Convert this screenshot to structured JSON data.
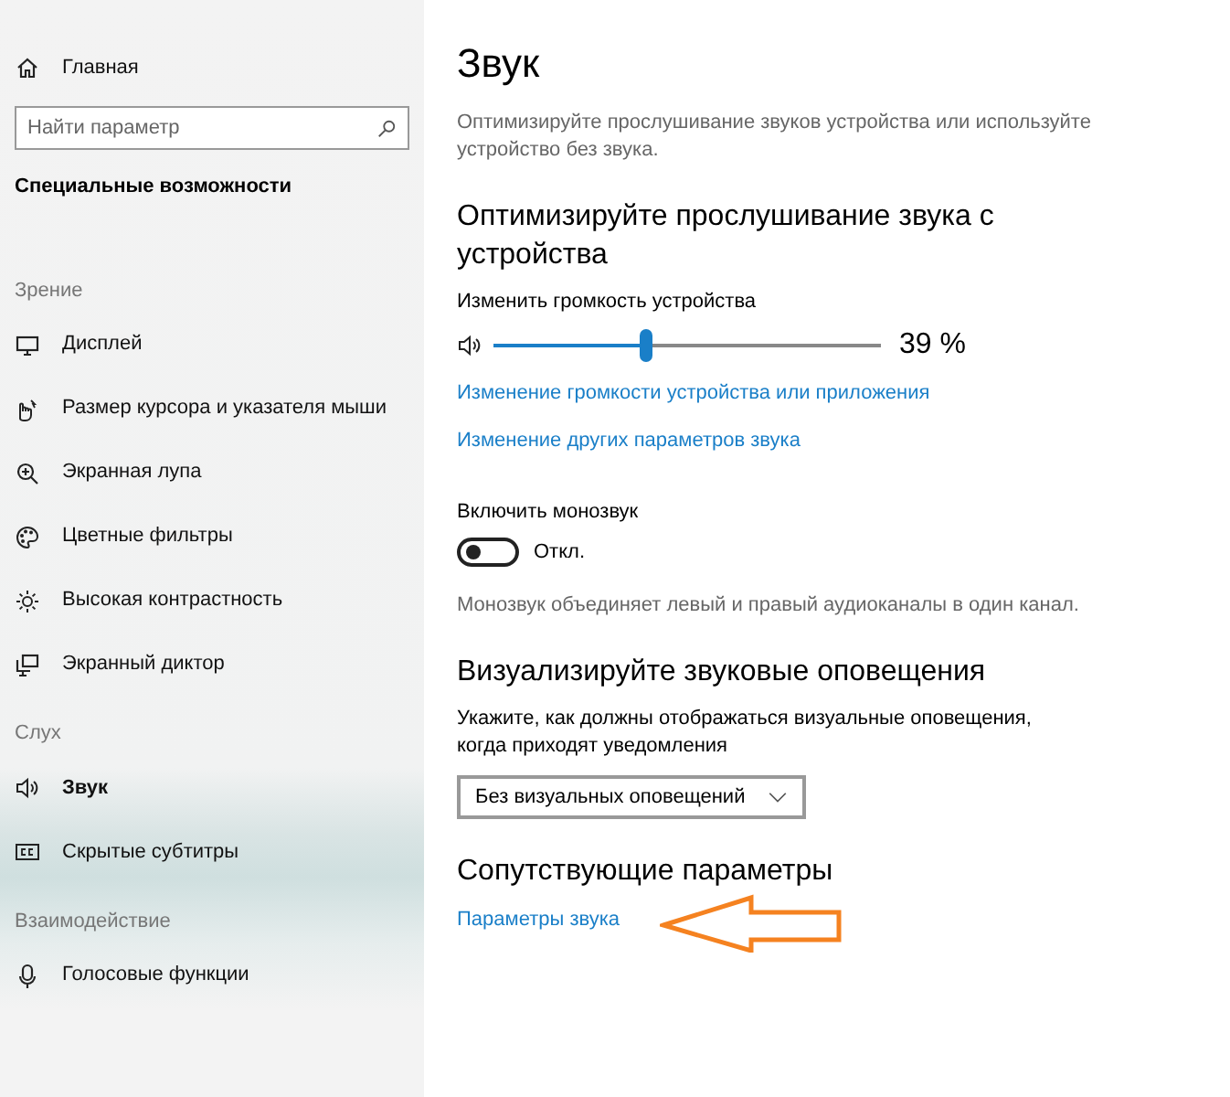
{
  "sidebar": {
    "home": "Главная",
    "search": {
      "placeholder": "Найти параметр"
    },
    "title": "Специальные возможности",
    "groups": [
      {
        "heading": "Зрение",
        "items": [
          {
            "label": "Дисплей",
            "selected": false
          },
          {
            "label": "Размер курсора и указателя мыши",
            "selected": false
          },
          {
            "label": "Экранная лупа",
            "selected": false
          },
          {
            "label": "Цветные фильтры",
            "selected": false
          },
          {
            "label": "Высокая контрастность",
            "selected": false
          },
          {
            "label": "Экранный диктор",
            "selected": false
          }
        ]
      },
      {
        "heading": "Слух",
        "items": [
          {
            "label": "Звук",
            "selected": true
          },
          {
            "label": "Скрытые субтитры",
            "selected": false
          }
        ]
      },
      {
        "heading": "Взаимодействие",
        "items": [
          {
            "label": "Голосовые функции",
            "selected": false
          }
        ]
      }
    ]
  },
  "main": {
    "title": "Звук",
    "description": "Оптимизируйте прослушивание звуков устройства или используйте устройство без звука.",
    "sections": [
      {
        "heading": "Оптимизируйте прослушивание звука с устройства",
        "volume": {
          "label": "Изменить громкость устройства",
          "level": 0.39,
          "reading": "39 %"
        },
        "links": [
          "Изменение громкости устройства или приложения",
          "Изменение других параметров звука"
        ],
        "toggle": {
          "label": "Включить монозвук",
          "on": false,
          "state_text": "Откл."
        },
        "note": "Монозвук объединяет левый и правый аудиоканалы в один канал."
      },
      {
        "heading": "Визуализируйте звуковые оповещения",
        "prompt": "Укажите, как должны отображаться визуальные оповещения, когда приходят уведомления",
        "dropdown": "Без визуальных оповещений"
      },
      {
        "heading": "Сопутствующие параметры",
        "links": [
          "Параметры звука"
        ]
      }
    ]
  }
}
